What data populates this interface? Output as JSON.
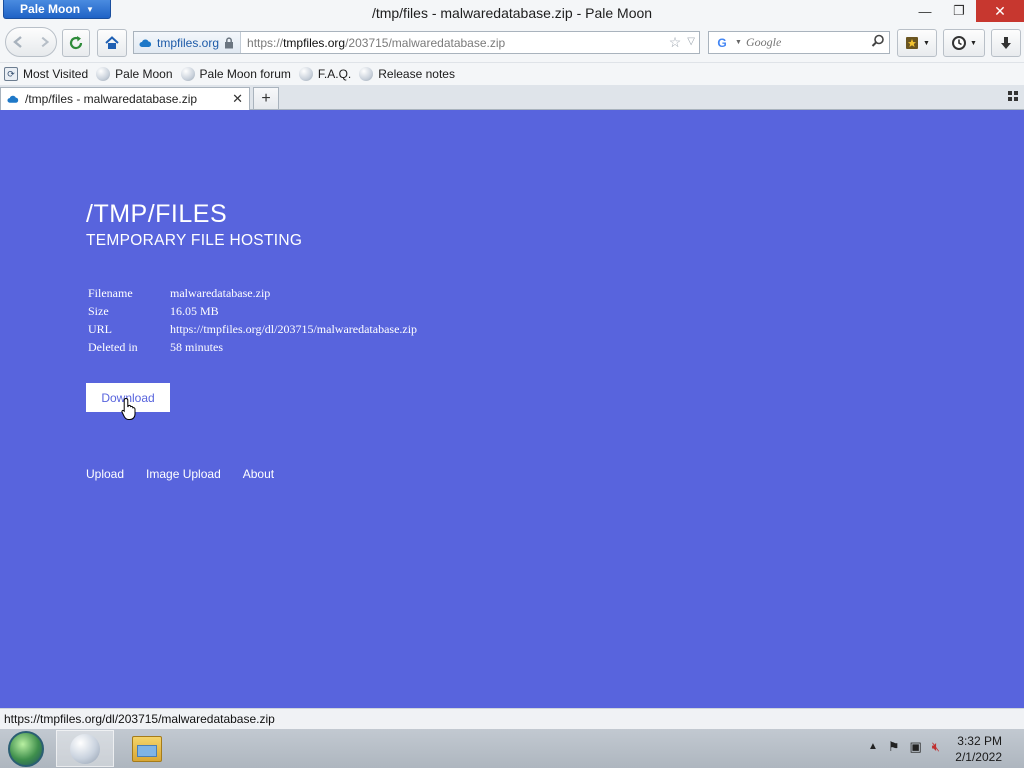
{
  "browser": {
    "app_menu_label": "Pale Moon",
    "window_title": "/tmp/files - malwaredatabase.zip - Pale Moon",
    "identity_label": "tmpfiles.org",
    "url_scheme": "https://",
    "url_host": "tmpfiles.org",
    "url_path": "/203715/malwaredatabase.zip",
    "search_engine": "G",
    "search_placeholder": "Google"
  },
  "bookmarks": [
    {
      "label": "Most Visited",
      "icon": "most-visited-icon"
    },
    {
      "label": "Pale Moon",
      "icon": "globe-icon"
    },
    {
      "label": "Pale Moon forum",
      "icon": "globe-icon"
    },
    {
      "label": "F.A.Q.",
      "icon": "globe-icon"
    },
    {
      "label": "Release notes",
      "icon": "globe-icon"
    }
  ],
  "tabs": [
    {
      "title": "/tmp/files - malwaredatabase.zip",
      "active": true
    }
  ],
  "page": {
    "title": "/TMP/FILES",
    "subtitle": "TEMPORARY FILE HOSTING",
    "info": [
      {
        "key": "Filename",
        "value": "malwaredatabase.zip"
      },
      {
        "key": "Size",
        "value": "16.05 MB"
      },
      {
        "key": "URL",
        "value": "https://tmpfiles.org/dl/203715/malwaredatabase.zip"
      },
      {
        "key": "Deleted in",
        "value": "58 minutes"
      }
    ],
    "download_label": "Download",
    "footer_links": [
      "Upload",
      "Image Upload",
      "About"
    ],
    "background_color": "#5864dd"
  },
  "statusbar": {
    "text": "https://tmpfiles.org/dl/203715/malwaredatabase.zip"
  },
  "taskbar": {
    "time": "3:32 PM",
    "date": "2/1/2022"
  }
}
